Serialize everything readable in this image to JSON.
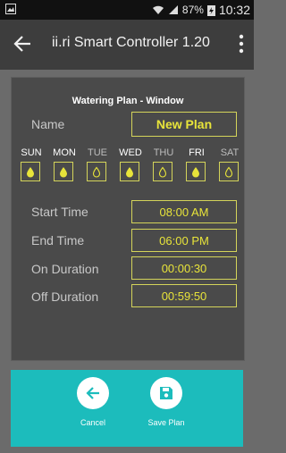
{
  "status_bar": {
    "battery": "87%",
    "time": "10:32"
  },
  "app_bar": {
    "title": "ii.ri Smart Controller 1.20",
    "back_icon": "arrow-left-icon",
    "menu_icon": "more-vert-icon"
  },
  "plan": {
    "heading": "Watering Plan - Window",
    "name_label": "Name",
    "name_value": "New Plan",
    "days": [
      {
        "label": "SUN",
        "active": true
      },
      {
        "label": "MON",
        "active": true
      },
      {
        "label": "TUE",
        "active": false
      },
      {
        "label": "WED",
        "active": true
      },
      {
        "label": "THU",
        "active": false
      },
      {
        "label": "FRI",
        "active": true
      },
      {
        "label": "SAT",
        "active": false
      }
    ],
    "start_time_label": "Start Time",
    "start_time_value": "08:00 AM",
    "end_time_label": "End Time",
    "end_time_value": "06:00 PM",
    "on_duration_label": "On Duration",
    "on_duration_value": "00:00:30",
    "off_duration_label": "Off Duration",
    "off_duration_value": "00:59:50"
  },
  "actions": {
    "cancel_label": "Cancel",
    "save_label": "Save Plan"
  },
  "colors": {
    "accent_yellow": "#e8e43a",
    "action_bar": "#1cbcbc"
  }
}
